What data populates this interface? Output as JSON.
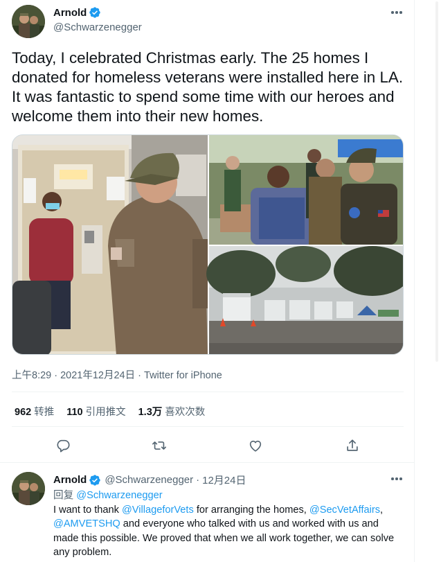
{
  "colors": {
    "accent": "#1d9bf0",
    "secondary_text": "#536471",
    "divider": "#eff3f4"
  },
  "tweet": {
    "author": {
      "name": "Arnold",
      "handle": "@Schwarzenegger",
      "verified_icon": "verified-badge-icon",
      "avatar_icon": "avatar-photo"
    },
    "more_icon": "more-horizontal-icon",
    "text": "Today, I celebrated Christmas early. The 25 homes I donated for homeless veterans were installed here in LA. It was fantastic to spend some time with our heroes and welcome them into their new homes.",
    "meta": "上午8:29 · 2021年12月24日 · Twitter for iPhone",
    "stats": [
      {
        "count": "962",
        "label": "转推"
      },
      {
        "count": "110",
        "label": "引用推文"
      },
      {
        "count": "1.3万",
        "label": "喜欢次数"
      }
    ],
    "actions": [
      {
        "icon": "reply-icon"
      },
      {
        "icon": "retweet-icon"
      },
      {
        "icon": "like-icon"
      },
      {
        "icon": "share-icon"
      }
    ],
    "photos": [
      "photo-veteran-at-tiny-home-door",
      "photo-veterans-gathering",
      "photo-row-of-tiny-homes"
    ]
  },
  "reply": {
    "author": {
      "name": "Arnold",
      "handle": "@Schwarzenegger",
      "date": "12月24日",
      "verified_icon": "verified-badge-icon"
    },
    "replying_prefix": "回复",
    "replying_to": "@Schwarzenegger",
    "body": [
      {
        "t": "text",
        "v": "I want to thank "
      },
      {
        "t": "link",
        "v": "@VillageforVets"
      },
      {
        "t": "text",
        "v": " for arranging the homes, "
      },
      {
        "t": "link",
        "v": "@SecVetAffairs"
      },
      {
        "t": "text",
        "v": ", "
      },
      {
        "t": "link",
        "v": "@AMVETSHQ"
      },
      {
        "t": "text",
        "v": " and everyone who talked with us and worked with us and made this possible. We proved that when we all work together, we can solve any problem."
      }
    ]
  }
}
